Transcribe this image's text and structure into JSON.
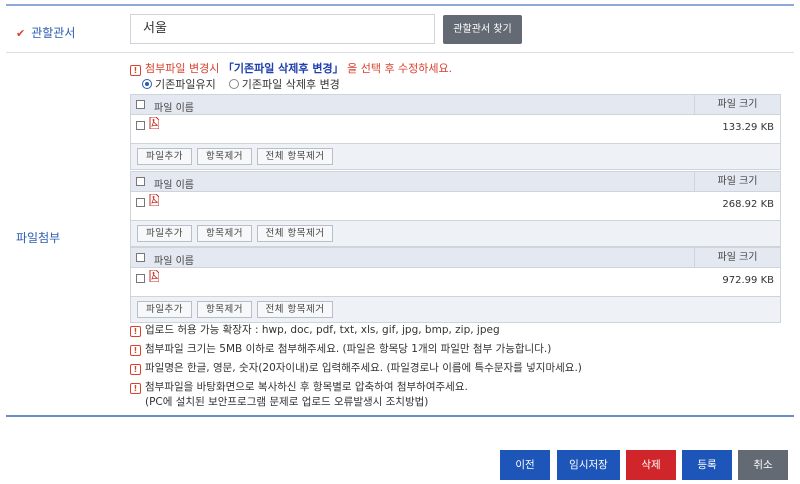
{
  "office": {
    "label": "관할관서",
    "value": "서울",
    "find_button": "관할관서 찾기"
  },
  "attachment": {
    "label": "파일첨부",
    "notice_prefix": "첨부파일 변경시 ",
    "notice_highlight": "「기존파일 삭제후 변경」",
    "notice_suffix": " 을 선택 후 수정하세요.",
    "radio_keep": "기존파일유지",
    "radio_replace": "기존파일 삭제후 변경",
    "header_name": "파일 이름",
    "header_size": "파일 크기",
    "add_button": "파일추가",
    "remove_button": "항목제거",
    "remove_all_button": "전체 항목제거",
    "files": [
      {
        "size": "133.29 KB"
      },
      {
        "size": "268.92 KB"
      },
      {
        "size": "972.99 KB"
      }
    ]
  },
  "notes": [
    "업로드 허용 가능 확장자 : hwp, doc, pdf, txt, xls, gif, jpg, bmp, zip, jpeg",
    "첨부파일 크기는 5MB 이하로 첨부해주세요. (파일은 항목당 1개의 파일만 첨부 가능합니다.)",
    "파일명은 한글, 영문, 숫자(20자이내)로 입력해주세요. (파일경로나 이름에 특수문자를 넣지마세요.)",
    "첨부파일을 바탕화면으로 복사하신 후 항목별로 압축하여 첨부하여주세요."
  ],
  "note_sub": "(PC에 설치된 보안프로그램 문제로 업로드 오류발생시 조치방법)",
  "actions": {
    "prev": "이전",
    "temp_save": "임시저장",
    "delete": "삭제",
    "register": "등록",
    "cancel": "취소"
  },
  "colors": {
    "accent": "#2a5db0",
    "warning": "#d9412f",
    "blue_button": "#1e55b8",
    "red_button": "#d0262b",
    "gray_button": "#646a73"
  }
}
